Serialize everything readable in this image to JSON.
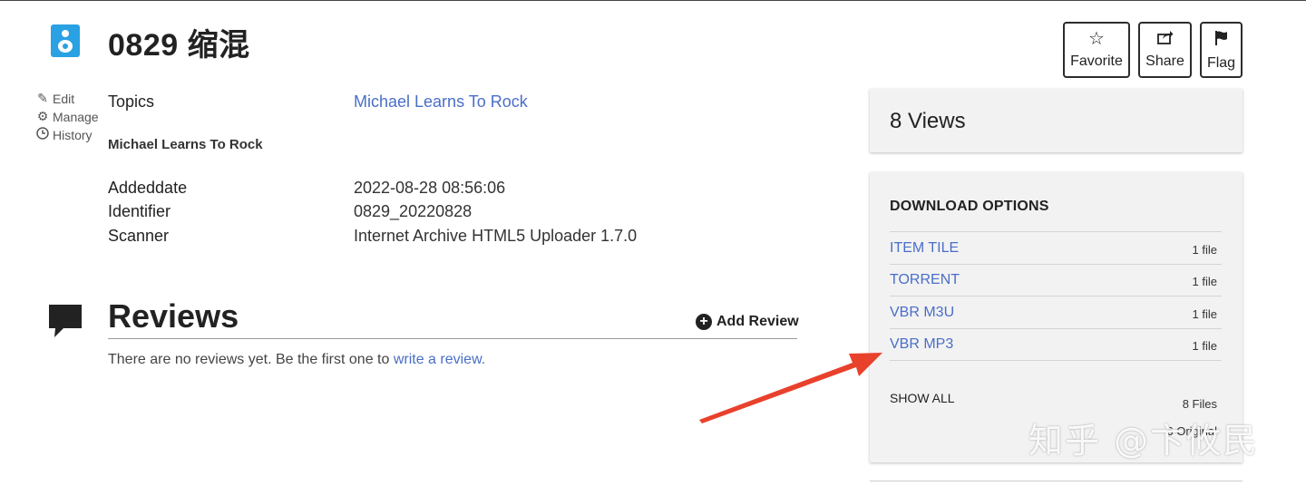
{
  "header": {
    "title": "0829 缩混",
    "item_icon": "audio-speaker-icon"
  },
  "actions": {
    "favorite": {
      "label": "Favorite",
      "icon": "star-icon"
    },
    "share": {
      "label": "Share",
      "icon": "share-icon"
    },
    "flag": {
      "label": "Flag",
      "icon": "flag-icon"
    }
  },
  "tools": {
    "edit": {
      "label": "Edit",
      "icon": "pencil-icon"
    },
    "manage": {
      "label": "Manage",
      "icon": "gear-icon"
    },
    "history": {
      "label": "History",
      "icon": "clock-icon"
    }
  },
  "metadata": {
    "topics_key": "Topics",
    "topics_value": "Michael Learns To Rock",
    "description": "Michael Learns To Rock",
    "rows": [
      {
        "key": "Addeddate",
        "value": "2022-08-28 08:56:06"
      },
      {
        "key": "Identifier",
        "value": "0829_20220828"
      },
      {
        "key": "Scanner",
        "value": "Internet Archive HTML5 Uploader 1.7.0"
      }
    ]
  },
  "reviews": {
    "title": "Reviews",
    "add_label": "Add Review",
    "empty_text": "There are no reviews yet. Be the first one to ",
    "empty_link": "write a review."
  },
  "stats": {
    "views": "8 Views"
  },
  "downloads": {
    "header": "DOWNLOAD OPTIONS",
    "options": [
      {
        "label": "ITEM TILE",
        "count": "1 file"
      },
      {
        "label": "TORRENT",
        "count": "1 file"
      },
      {
        "label": "VBR M3U",
        "count": "1 file"
      },
      {
        "label": "VBR MP3",
        "count": "1 file"
      }
    ],
    "show_all": "SHOW ALL",
    "files_count": "8 Files",
    "original_count": "6 Original"
  },
  "annotation": {
    "arrow_color": "#e8412c",
    "watermark": "知乎 @卞攸民"
  },
  "colors": {
    "link": "#4a6ec7",
    "icon_blue": "#2aa1e3",
    "panel_bg": "#f2f2f2"
  }
}
